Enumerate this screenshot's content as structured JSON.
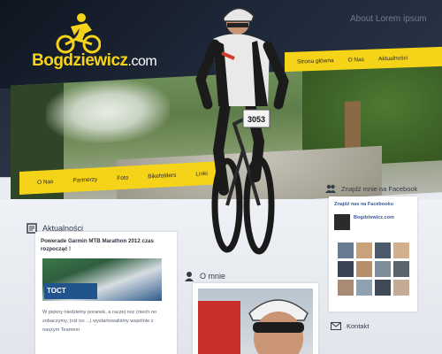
{
  "site": {
    "logo_main": "Bogdziewicz",
    "logo_tld": ".com",
    "header_note": "About Lorem ipsum"
  },
  "topnav": {
    "items": [
      "Strona główna",
      "O Nas",
      "Aktualności"
    ]
  },
  "subnav": {
    "items": [
      "O Nas",
      "Partnerzy",
      "Foto",
      "Bikefolders",
      "Linki"
    ]
  },
  "hero": {
    "race_number": "3053"
  },
  "news": {
    "heading": "Aktualności",
    "title": "Powerade Garmin MTB Marathon 2012 czas rozpocząć !",
    "banner": "TOCT",
    "text": "W piękny niedzielny poranek, a raczej noc (niech no zobaczymy, (niż no ...) wystartowaliśmy wspólnie z naszym Teamem"
  },
  "about": {
    "heading": "O mnie"
  },
  "facebook": {
    "heading": "Znajdź mnie na Facebook",
    "box_title": "Znajdź nas na Facebooku",
    "page_name": "Bogdziewicz.com",
    "avatar_colors": [
      "#6a7c93",
      "#c9a27c",
      "#4c5b6c",
      "#d2b08d",
      "#394554",
      "#b58f6a",
      "#7d8c99",
      "#59646f",
      "#a98a74",
      "#8fa0b0",
      "#3f4a56",
      "#c4ab96"
    ]
  },
  "contact": {
    "heading": "Kontakt"
  },
  "colors": {
    "accent": "#f5d318",
    "header_bg": "#1d2636"
  }
}
